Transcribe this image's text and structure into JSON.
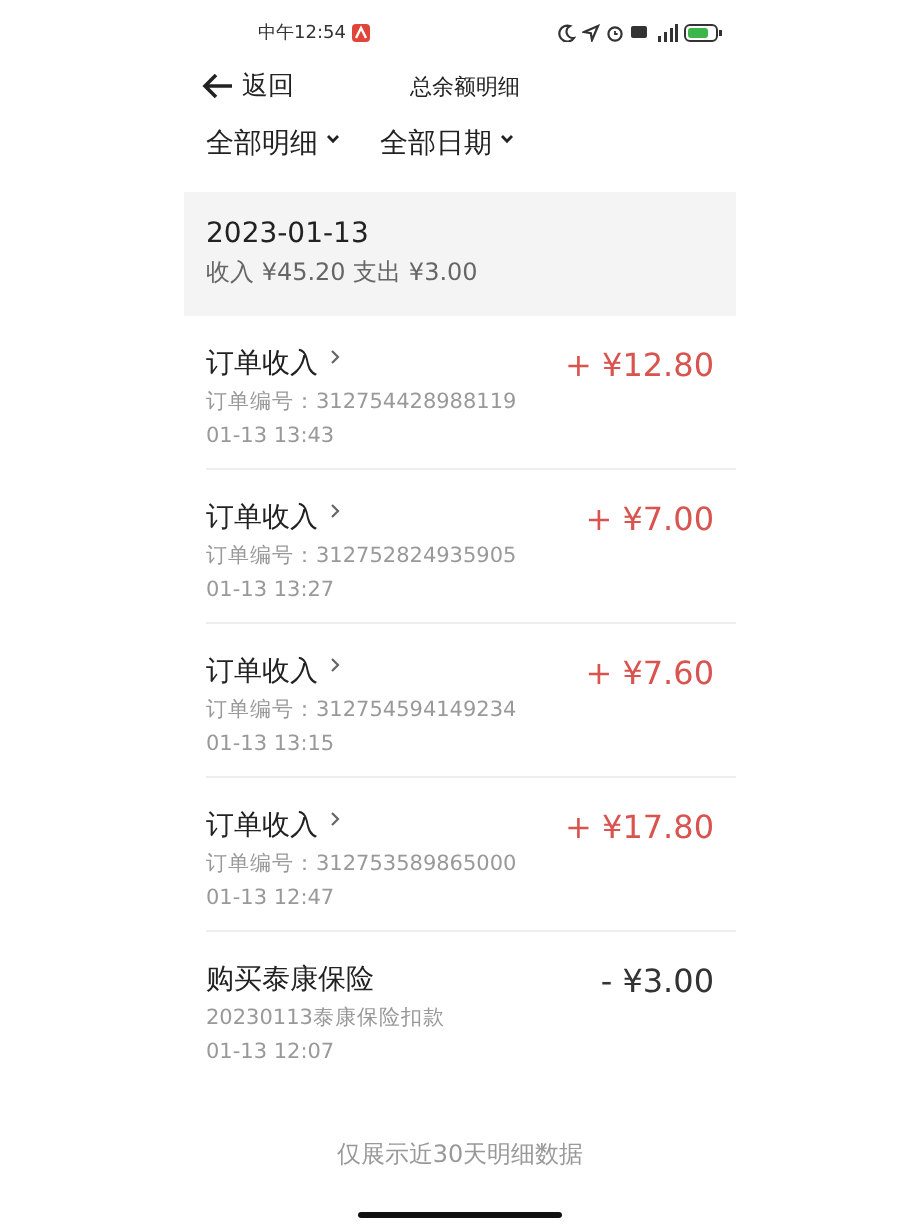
{
  "status_bar": {
    "time": "中午12:54"
  },
  "header": {
    "back_label": "返回",
    "title": "总余额明细"
  },
  "filters": [
    {
      "label": "全部明细"
    },
    {
      "label": "全部日期"
    }
  ],
  "day_group": {
    "date": "2023-01-13",
    "summary": "收入 ¥45.20   支出 ¥3.00"
  },
  "records": [
    {
      "kind": "income",
      "title": "订单收入",
      "detail": "订单编号：312754428988119",
      "time": "01-13 13:43",
      "amount": "+ ¥12.80"
    },
    {
      "kind": "income",
      "title": "订单收入",
      "detail": "订单编号：312752824935905",
      "time": "01-13 13:27",
      "amount": "+ ¥7.00"
    },
    {
      "kind": "income",
      "title": "订单收入",
      "detail": "订单编号：312754594149234",
      "time": "01-13 13:15",
      "amount": "+ ¥7.60"
    },
    {
      "kind": "income",
      "title": "订单收入",
      "detail": "订单编号：312753589865000",
      "time": "01-13 12:47",
      "amount": "+ ¥17.80"
    },
    {
      "kind": "expense",
      "title": "购买泰康保险",
      "detail": "20230113泰康保险扣款",
      "time": "01-13 12:07",
      "amount": "- ¥3.00"
    }
  ],
  "footer_note": "仅展示近30天明细数据"
}
